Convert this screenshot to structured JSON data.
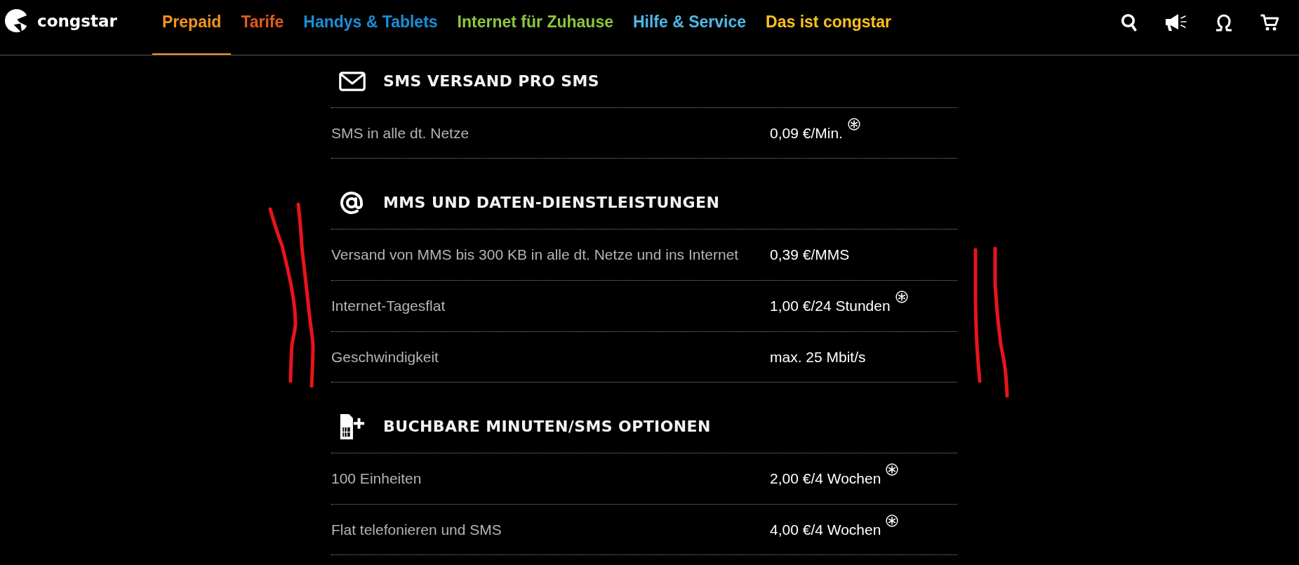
{
  "brand": {
    "name": "congstar"
  },
  "nav": [
    {
      "label": "Prepaid",
      "color": "#f7941d",
      "selected": true
    },
    {
      "label": "Tarife",
      "color": "#e35b1c",
      "selected": false
    },
    {
      "label": "Handys & Tablets",
      "color": "#1a8fd8",
      "selected": false
    },
    {
      "label": "Internet für Zuhause",
      "color": "#8dc63f",
      "selected": false
    },
    {
      "label": "Hilfe & Service",
      "color": "#4fb8e8",
      "selected": false
    },
    {
      "label": "Das ist congstar",
      "color": "#fcc21b",
      "selected": false
    }
  ],
  "sections": [
    {
      "kind": "sms",
      "title": "SMS VERSAND PRO SMS",
      "rows": [
        {
          "label": "SMS in alle dt. Netze",
          "value": "0,09 €/Min.",
          "footnote": true
        }
      ]
    },
    {
      "kind": "data",
      "title": "MMS UND DATEN-DIENSTLEISTUNGEN",
      "rows": [
        {
          "label": "Versand von MMS bis 300 KB in alle dt. Netze und ins Internet",
          "value": "0,39 €/MMS",
          "footnote": false
        },
        {
          "label": "Internet-Tagesflat",
          "value": "1,00 €/24 Stunden",
          "footnote": true
        },
        {
          "label": "Geschwindigkeit",
          "value": "max. 25 Mbit/s",
          "footnote": false
        }
      ]
    },
    {
      "kind": "options",
      "title": "BUCHBARE MINUTEN/SMS OPTIONEN",
      "rows": [
        {
          "label": "100 Einheiten",
          "value": "2,00 €/4 Wochen",
          "footnote": true
        },
        {
          "label": "Flat telefonieren und SMS",
          "value": "4,00 €/4 Wochen",
          "footnote": true
        }
      ]
    }
  ]
}
